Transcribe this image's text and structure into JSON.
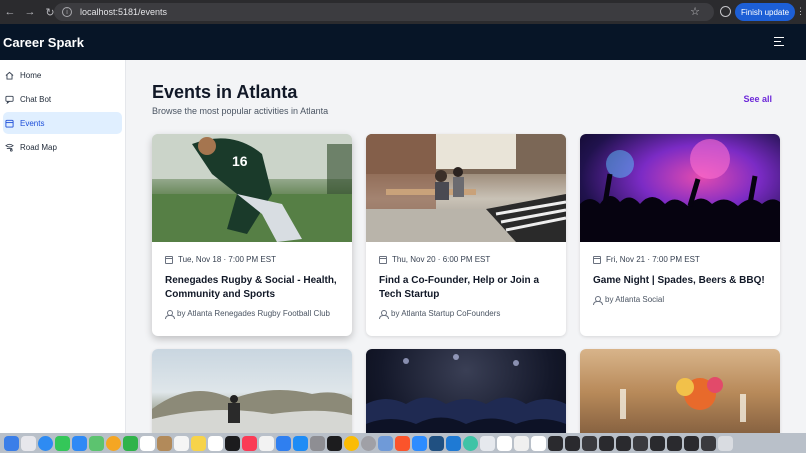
{
  "browser": {
    "url": "localhost:5181/events",
    "update_label": "Finish update"
  },
  "header": {
    "brand": "Career Spark"
  },
  "sidebar": {
    "items": [
      {
        "label": "Home",
        "icon": "home-icon"
      },
      {
        "label": "Chat Bot",
        "icon": "chat-icon"
      },
      {
        "label": "Events",
        "icon": "calendar-icon",
        "active": true
      },
      {
        "label": "Road Map",
        "icon": "map-icon"
      }
    ]
  },
  "main": {
    "title": "Events in Atlanta",
    "subtitle": "Browse the most popular activities in Atlanta",
    "see_all": "See all",
    "events": [
      {
        "date": "Tue, Nov 18 · 7:00 PM EST",
        "name": "Renegades Rugby & Social - Health, Community and Sports",
        "host": "by Atlanta Renegades Rugby Football Club",
        "image": "rugby-player"
      },
      {
        "date": "Thu, Nov 20 · 6:00 PM EST",
        "name": "Find a Co-Founder, Help or Join a Tech Startup",
        "host": "by Atlanta Startup CoFounders",
        "image": "office-workspace"
      },
      {
        "date": "Fri, Nov 21 · 7:00 PM EST",
        "name": "Game Night | Spades, Beers & BBQ!",
        "host": "by Atlanta Social",
        "image": "concert-crowd"
      },
      {
        "image": "mountain-photographer"
      },
      {
        "image": "conference-audience"
      },
      {
        "image": "dinner-table"
      }
    ]
  },
  "colors": {
    "header_bg": "#071527",
    "accent_link": "#6d28d9",
    "active_nav_bg": "#e0efff",
    "active_nav_text": "#1d4ed8",
    "update_button": "#1d5fd6"
  }
}
